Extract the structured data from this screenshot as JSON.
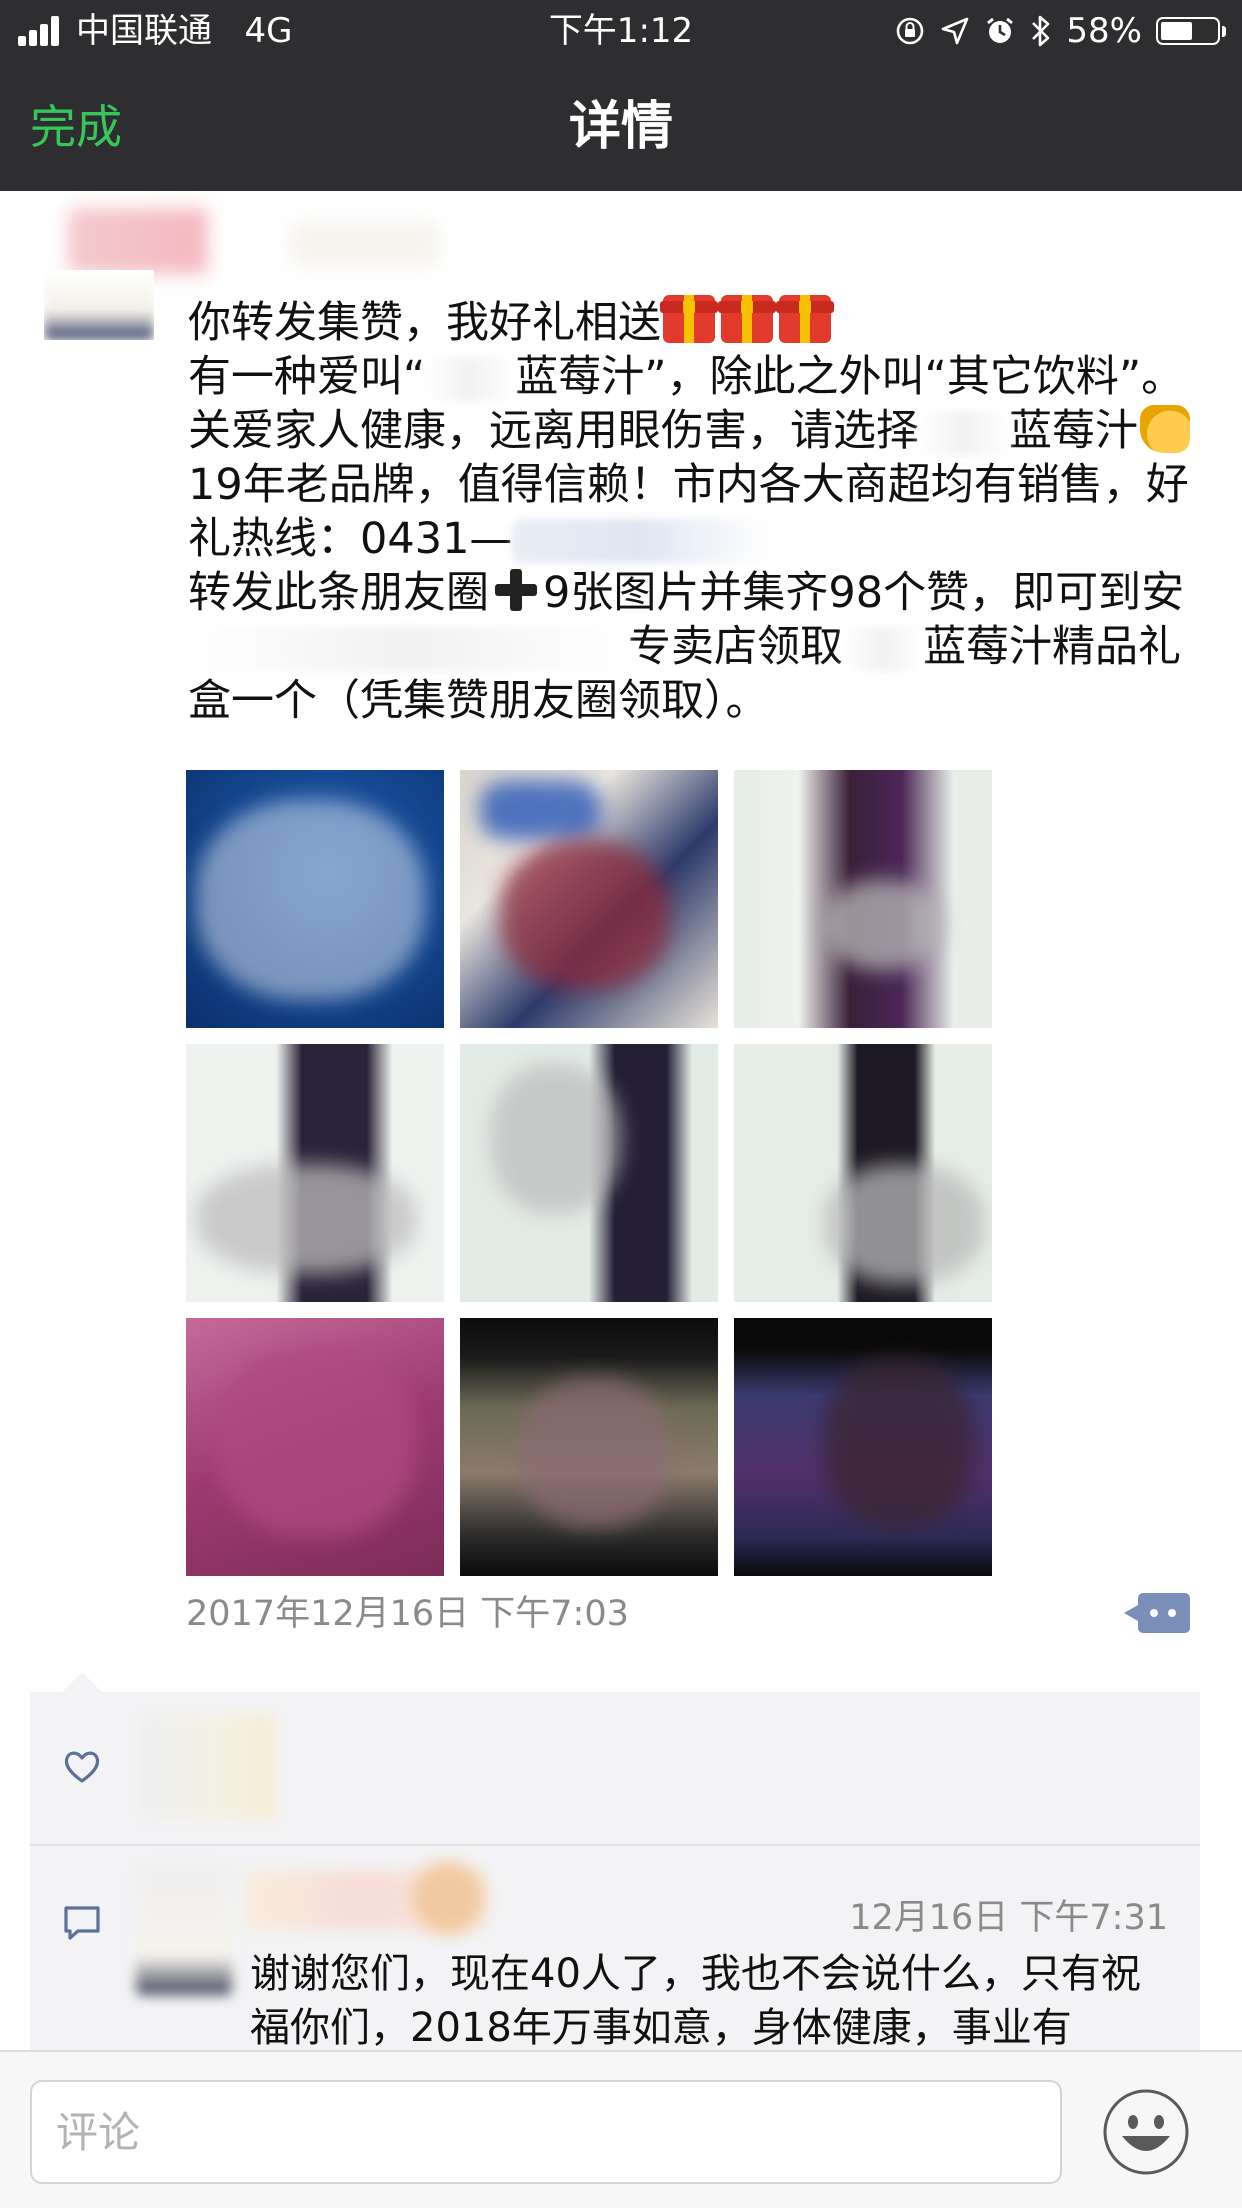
{
  "status_bar": {
    "carrier": "中国联通",
    "network": "4G",
    "time": "下午1:12",
    "battery_percent": "58%",
    "battery_level": 0.58,
    "icons": [
      "signal-icon",
      "orientation-lock-icon",
      "location-icon",
      "alarm-icon",
      "bluetooth-icon",
      "battery-icon"
    ]
  },
  "nav": {
    "done_label": "完成",
    "title": "详情"
  },
  "post": {
    "line1": "你转发集赞，我好礼相送",
    "line2_a": "有一种爱叫“",
    "line2_b": "蓝莓汁”，除此之外叫“其它饮料”。关爱家人健康，远离用眼伤害，请选择",
    "line2_c": "蓝莓汁",
    "line2_d": "19年老品牌，值得信赖！市内各大商超均有销售，好礼热线：0431—",
    "line3_a": "转发此条朋友圈",
    "line3_b": "9张图片并集齐98个赞，即可到安",
    "line3_c": "专卖店领取",
    "line3_d": "蓝莓汁精品礼盒一个（凭集赞朋友圈领取）。",
    "photo_count": 9,
    "timestamp": "2017年12月16日 下午7:03"
  },
  "comments": [
    {
      "time": "12月16日 下午7:31",
      "text": "谢谢您们，现在40人了，我也不会说什么，只有祝福你们，2018年万事如意，身体健康，事业有"
    }
  ],
  "input": {
    "placeholder": "评论"
  },
  "colors": {
    "header_bg": "#2e2e31",
    "accent_green": "#36c75b",
    "link_blue": "#7a8fb7",
    "comment_bg": "#f3f3f5"
  }
}
